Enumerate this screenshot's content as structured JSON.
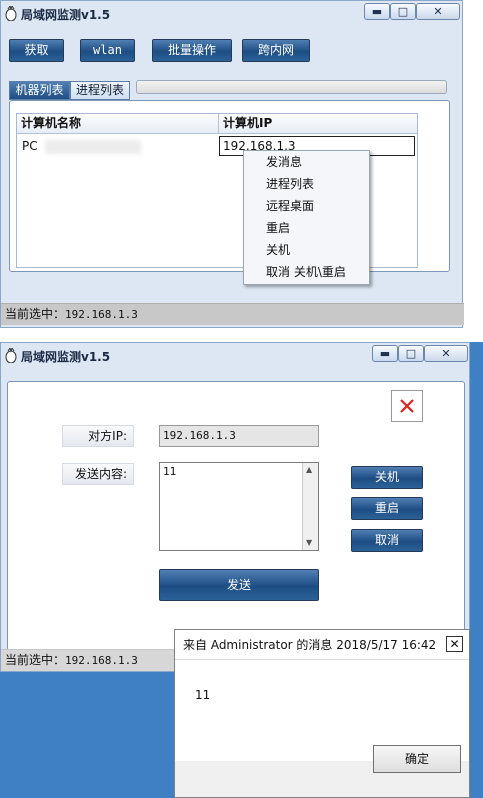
{
  "window1": {
    "title": "局域网监测v1.5",
    "controls": {
      "minimize": "▬",
      "maximize": "□",
      "close": "✕"
    },
    "toolbar": [
      "获取",
      "wlan",
      "批量操作",
      "跨内网"
    ],
    "tabs": [
      "机器列表",
      "进程列表"
    ],
    "table": {
      "headers": [
        "计算机名称",
        "计算机IP"
      ],
      "rows": [
        {
          "name": "PC",
          "ip": "192.168.1.3"
        }
      ]
    },
    "context_menu": [
      "发消息",
      "进程列表",
      "远程桌面",
      "重启",
      "关机",
      "取消 关机\\重启"
    ],
    "status_label": "当前选中：",
    "status_value": "192.168.1.3"
  },
  "window2": {
    "title": "局域网监测v1.5",
    "controls": {
      "minimize": "▬",
      "maximize": "□",
      "close": "✕"
    },
    "ip_label": "对方IP:",
    "ip_value": "192.168.1.3",
    "content_label": "发送内容:",
    "content_value": "11",
    "buttons": {
      "shutdown": "关机",
      "restart": "重启",
      "cancel": "取消",
      "send": "发送"
    },
    "status_label": "当前选中：",
    "status_value": "192.168.1.3"
  },
  "message_box": {
    "title": "来自 Administrator 的消息 2018/5/17 16:42",
    "close": "✕",
    "body": "11",
    "ok": "确定"
  }
}
